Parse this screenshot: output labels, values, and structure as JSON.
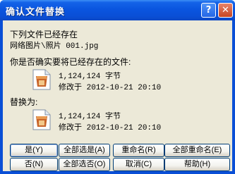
{
  "window": {
    "title": "确认文件替换",
    "help_glyph": "?",
    "close_glyph": "✕"
  },
  "message": {
    "line1": "下列文件已经存在",
    "path": "网络图片\\照片 001.jpg",
    "question": "你是否确实要将已经存在的文件:"
  },
  "existing_file": {
    "size": "1,124,124 字节",
    "modified": "修改于 2012-10-21 20:10",
    "icon": "image-file-icon"
  },
  "replace_label": "替换为:",
  "new_file": {
    "size": "1,124,124 字节",
    "modified": "修改于 2012-10-21 20:10",
    "icon": "image-file-icon"
  },
  "buttons": {
    "yes": "是(Y)",
    "yes_all": "全部选是(A)",
    "rename": "重命名(R)",
    "rename_all": "全部重命名(E)",
    "no": "否(N)",
    "no_all": "全部选否(O)",
    "cancel": "取消(C)",
    "help": "帮助(H)"
  },
  "colors": {
    "title_bar": "#0a4fd6",
    "dialog_face": "#ece9d8",
    "button_border": "#003c74",
    "close_button": "#c74523"
  }
}
